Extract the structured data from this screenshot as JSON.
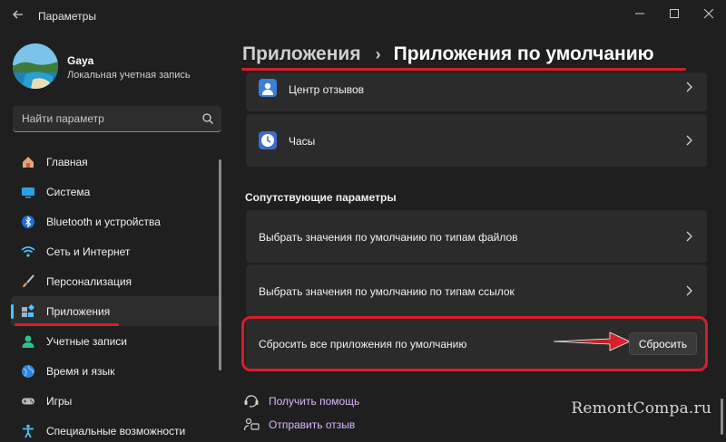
{
  "window": {
    "title": "Параметры"
  },
  "profile": {
    "name": "Gaya",
    "account_type": "Локальная учетная запись"
  },
  "search": {
    "placeholder": "Найти параметр"
  },
  "nav": {
    "items": [
      {
        "label": "Главная",
        "icon": "home-icon"
      },
      {
        "label": "Система",
        "icon": "system-icon"
      },
      {
        "label": "Bluetooth и устройства",
        "icon": "bluetooth-icon"
      },
      {
        "label": "Сеть и Интернет",
        "icon": "network-icon"
      },
      {
        "label": "Персонализация",
        "icon": "brush-icon"
      },
      {
        "label": "Приложения",
        "icon": "apps-icon",
        "active": true
      },
      {
        "label": "Учетные записи",
        "icon": "accounts-icon"
      },
      {
        "label": "Время и язык",
        "icon": "globe-icon"
      },
      {
        "label": "Игры",
        "icon": "gamepad-icon"
      },
      {
        "label": "Специальные возможности",
        "icon": "accessibility-icon"
      }
    ]
  },
  "header": {
    "parent": "Приложения",
    "current": "Приложения по умолчанию"
  },
  "apps": [
    {
      "label": "Центр отзывов",
      "icon": "feedback-hub-icon"
    },
    {
      "label": "Часы",
      "icon": "clock-icon"
    }
  ],
  "related": {
    "title": "Сопутствующие параметры",
    "items": [
      {
        "label": "Выбрать значения по умолчанию по типам файлов"
      },
      {
        "label": "Выбрать значения по умолчанию по типам ссылок"
      }
    ]
  },
  "reset": {
    "label": "Сбросить все приложения по умолчанию",
    "button": "Сбросить"
  },
  "links": {
    "help": "Получить помощь",
    "feedback": "Отправить отзыв"
  },
  "watermark": "RemontCompa.ru",
  "colors": {
    "accent": "#4cc2ff",
    "annotation_red": "#d81e28",
    "link": "#d8b6ff"
  }
}
